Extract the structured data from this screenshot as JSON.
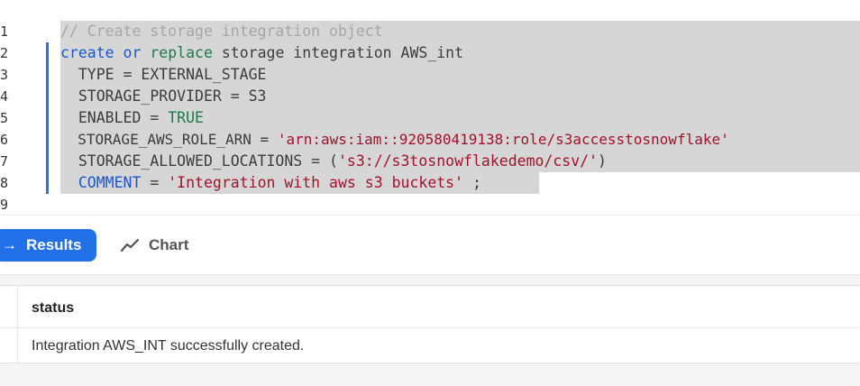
{
  "editor": {
    "lines": [
      {
        "num": "1",
        "text": "// Create storage integration object"
      },
      {
        "num": "2",
        "kw1": "create",
        "sp1": " ",
        "kw2": "or",
        "sp2": " ",
        "kw3": "replace",
        "rest": " storage integration AWS_int"
      },
      {
        "num": "3",
        "text": "  TYPE = EXTERNAL_STAGE"
      },
      {
        "num": "4",
        "text": "  STORAGE_PROVIDER = S3"
      },
      {
        "num": "5",
        "pre": "  ENABLED = ",
        "bool": "TRUE"
      },
      {
        "num": "6",
        "pre": "  STORAGE_AWS_ROLE_ARN = ",
        "str": "'arn:aws:iam::920580419138:role/s3accesstosnowflake'"
      },
      {
        "num": "7",
        "pre": "  STORAGE_ALLOWED_LOCATIONS = (",
        "str": "'s3://s3tosnowflakedemo/csv/'",
        "post": ")"
      },
      {
        "num": "8",
        "indent": "  ",
        "kw": "COMMENT",
        "mid": " = ",
        "str": "'Integration with aws s3 buckets'",
        "post": " ;"
      },
      {
        "num": "9",
        "text": ""
      }
    ]
  },
  "toolbar": {
    "results_label": "Results",
    "chart_label": "Chart",
    "accent": "#2170e8"
  },
  "results": {
    "columns": [
      "status"
    ],
    "rows": [
      [
        "Integration AWS_INT successfully created."
      ]
    ]
  }
}
